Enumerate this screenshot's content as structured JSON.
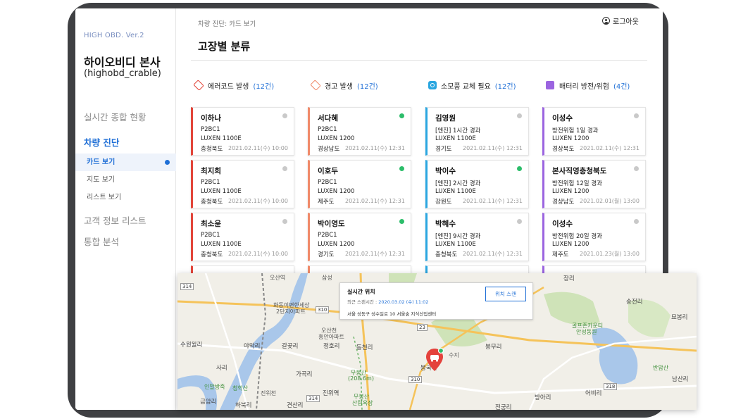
{
  "sidebar": {
    "version": "HIGH OBD. Ver.2",
    "org_name": "하이오비디 본사",
    "org_id": "(highobd_crable)",
    "nav": {
      "realtime": "실시간 종합 현황",
      "diagnosis": "차량 진단",
      "card_view": "카드 보기",
      "map_view": "지도 보기",
      "list_view": "리스트 보기",
      "customers": "고객 정보 리스트",
      "analysis": "통합 분석"
    }
  },
  "header": {
    "breadcrumb": "차량 진단: 카드 보기",
    "title": "고장별 분류",
    "logout": "로그아웃"
  },
  "columns": [
    {
      "label": "에러코드 발생",
      "count": "(12건)",
      "color": "#e2453a",
      "cards": [
        {
          "name": "이하나",
          "line1": "P2BC1",
          "line2": "LUXEN 1100E",
          "region": "충청북도",
          "time": "2021.02.11(수) 10:00",
          "online": false
        },
        {
          "name": "최지희",
          "line1": "P2BC1",
          "line2": "LUXEN 1100E",
          "region": "충청북도",
          "time": "2021.02.11(수) 10:00",
          "online": false
        },
        {
          "name": "최소윤",
          "line1": "P2BC1",
          "line2": "LUXEN 1100E",
          "region": "충청북도",
          "time": "2021.02.11(수) 10:00",
          "online": false
        }
      ]
    },
    {
      "label": "경고 발생",
      "count": "(12건)",
      "color": "#f08a6a",
      "cards": [
        {
          "name": "서다혜",
          "line1": "P2BC1",
          "line2": "LUXEN 1200",
          "region": "경상남도",
          "time": "2021.02.11(수) 12:31",
          "online": true
        },
        {
          "name": "이호두",
          "line1": "P2BC1",
          "line2": "LUXEN 1200",
          "region": "제주도",
          "time": "2021.02.11(수) 12:31",
          "online": true
        },
        {
          "name": "박이영도",
          "line1": "P2BC1",
          "line2": "LUXEN 1200",
          "region": "경기도",
          "time": "2021.02.11(수) 12:31",
          "online": true
        }
      ]
    },
    {
      "label": "소모품 교체 필요",
      "count": "(12건)",
      "color": "#2aa6e0",
      "cards": [
        {
          "name": "김영원",
          "line1": "[엔진] 1시간 경과",
          "line2": "LUXEN 1100E",
          "region": "경기도",
          "time": "2021.02.11(수) 12:31",
          "online": false
        },
        {
          "name": "박이수",
          "line1": "[엔진] 2시간 경과",
          "line2": "LUXEN 1100E",
          "region": "강원도",
          "time": "2021.02.11(수) 12:31",
          "online": true
        },
        {
          "name": "박혜수",
          "line1": "[엔진] 9시간 경과",
          "line2": "LUXEN 1100E",
          "region": "충청북도",
          "time": "2021.02.11(수) 12:31",
          "online": false
        }
      ]
    },
    {
      "label": "배터리 방전/위험",
      "count": "(4건)",
      "color": "#9b64e0",
      "cards": [
        {
          "name": "이성수",
          "line1": "방전위험 1일 경과",
          "line2": "LUXEN 1200",
          "region": "경상북도",
          "time": "2021.02.11(수) 12:31",
          "online": false
        },
        {
          "name": "본사직영충청북도",
          "line1": "방전위험 12일 경과",
          "line2": "LUXEN 1200",
          "region": "경상남도",
          "time": "2021.02.01(월) 13:00",
          "online": false
        },
        {
          "name": "이성수",
          "line1": "방전위험 20일 경과",
          "line2": "LUXEN 1200",
          "region": "제주도",
          "time": "2021.01.23(월) 13:00",
          "online": false
        }
      ]
    }
  ],
  "map": {
    "info": {
      "title": "실시간 위치",
      "scan_label": "최근 스캔시간 :",
      "scan_time": "2020.03.02 (수) 11:02",
      "address": "서울 성동구 성수일로 10 서울숲 지식산업센터",
      "button": "위치 스캔"
    },
    "places": {
      "p1": "오산역",
      "p2": "삼성",
      "p3": "화동이편한세상",
      "p4": "2단지아파트",
      "p5": "오산천",
      "p6": "흥안아파트",
      "p7": "수원월리",
      "p8": "야막리",
      "p9": "갈곶리",
      "p10": "정호리",
      "p11": "동천리",
      "p12": "가곡리",
      "p13": "진위역",
      "p14": "사리",
      "p15": "인말방죽",
      "p16": "청학산",
      "p17": "진위천",
      "p18": "금암리",
      "p19": "하북리",
      "p20": "견산리",
      "p21": "무봉산",
      "p22": "(208.6m)",
      "p23": "무봉산",
      "p24": "산림욕장",
      "p25": "봉무리",
      "p26": "장리",
      "p27": "송전리",
      "p28": "묘봉리",
      "p29": "골프존카운티",
      "p30": "안성동원",
      "p31": "반암산",
      "p32": "남산리",
      "p33": "어비리",
      "p34": "방아리",
      "p35": "전궁리",
      "p36": "봉국리",
      "p37": "수지",
      "r1": "314",
      "r2": "310",
      "r3": "23",
      "r4": "310",
      "r5": "318",
      "r6": "314"
    }
  }
}
